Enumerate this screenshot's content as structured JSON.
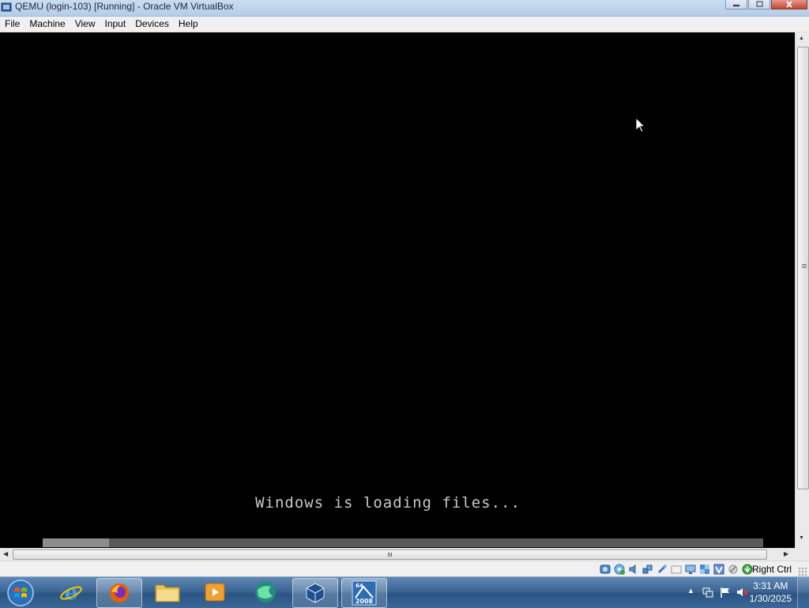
{
  "window": {
    "title": "QEMU (login-103) [Running] - Oracle VM VirtualBox"
  },
  "menu": [
    "File",
    "Machine",
    "View",
    "Input",
    "Devices",
    "Help"
  ],
  "guest": {
    "message": "Windows is loading files..."
  },
  "statusbar": {
    "host_key": "Right Ctrl"
  },
  "taskbar": {
    "pinned": [
      "internet-explorer",
      "firefox",
      "file-explorer",
      "media-player",
      "browser",
      "virtualbox",
      "windows-server-2008"
    ],
    "server_badge_top": "64",
    "server_badge_bottom": "2008"
  },
  "clock": {
    "time": "3:31 AM",
    "date": "1/30/2025"
  },
  "colors": {
    "vm_background": "#000000",
    "loading_text": "#c8c8c8",
    "taskbar": "#3c6594"
  }
}
